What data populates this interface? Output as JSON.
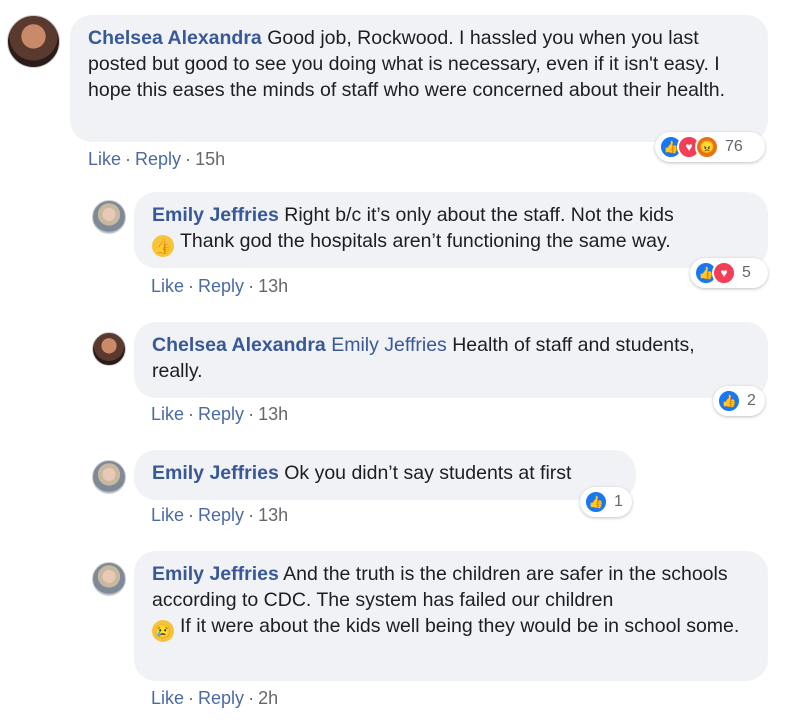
{
  "like_label": "Like",
  "reply_label": "Reply",
  "comments": [
    {
      "author": "Chelsea Alexandra",
      "text": "Good job, Rockwood. I hassled you when you last posted but good to see you doing what is necessary, even if it isn't easy. I hope this eases the minds of staff who were concerned about their health.",
      "time": "15h",
      "reaction_icons": [
        "like-icon",
        "love-icon",
        "angry-icon"
      ],
      "reaction_count": "76"
    },
    {
      "author": "Emily Jeffries",
      "text_a": "Right b/c it’s only about the staff. Not the kids",
      "emoji": "thumbs-up-icon",
      "text_b": "Thank god the hospitals aren’t functioning the same way.",
      "time": "13h",
      "reaction_icons": [
        "like-icon",
        "love-icon"
      ],
      "reaction_count": "5"
    },
    {
      "author": "Chelsea Alexandra",
      "mention": "Emily Jeffries",
      "text": "Health of staff and students, really.",
      "time": "13h",
      "reaction_icons": [
        "like-icon"
      ],
      "reaction_count": "2"
    },
    {
      "author": "Emily Jeffries",
      "text": "Ok you didn’t say students at first",
      "time": "13h",
      "reaction_icons": [
        "like-icon"
      ],
      "reaction_count": "1"
    },
    {
      "author": "Emily Jeffries",
      "text_a": "And the truth is the children are safer in the schools according to CDC. The system has failed our children",
      "emoji": "sad-face-icon",
      "text_b": "If it were about the kids well being they would be in school some.",
      "time": "2h"
    }
  ]
}
